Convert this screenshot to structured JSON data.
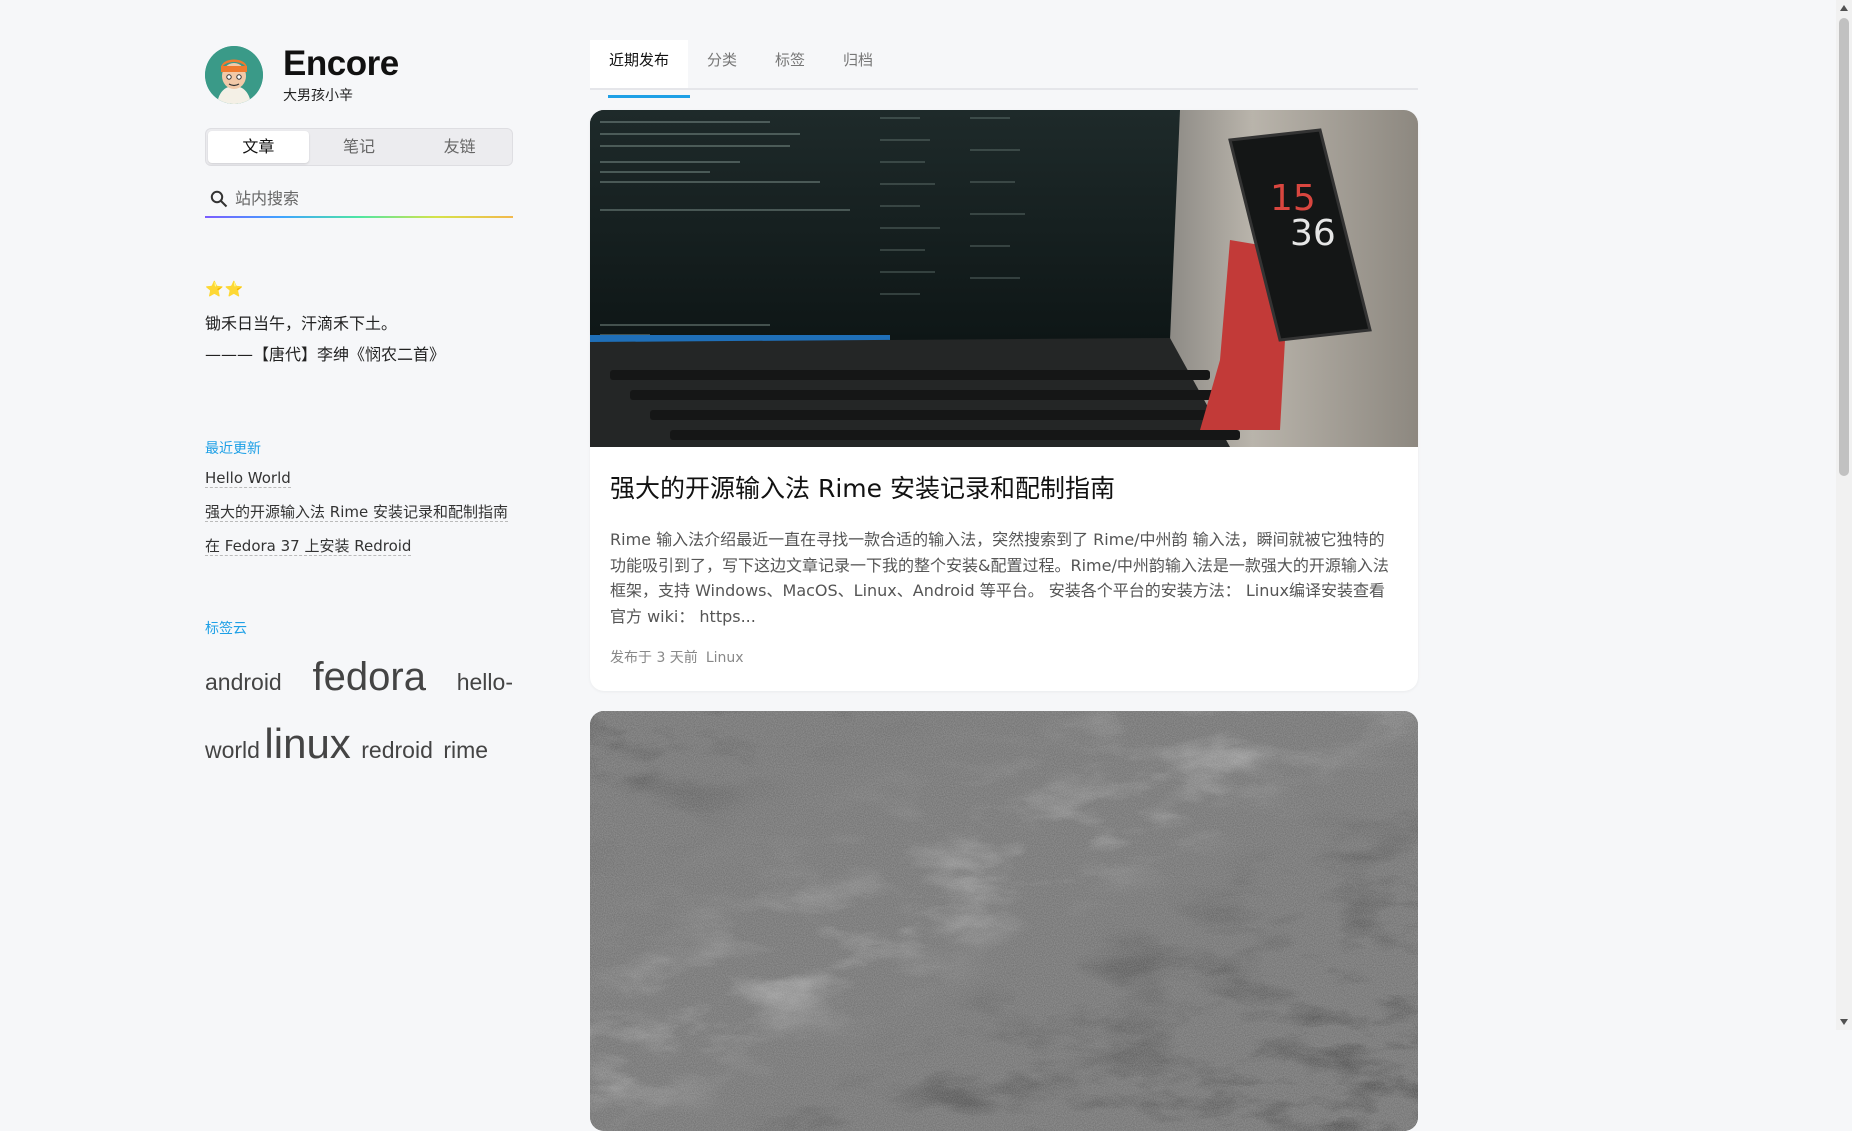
{
  "site": {
    "title": "Encore",
    "subtitle": "大男孩小辛"
  },
  "sidebar": {
    "segments": [
      "文章",
      "笔记",
      "友链"
    ],
    "search_placeholder": "站内搜索",
    "quote": {
      "stars": "⭐⭐",
      "line1": "锄禾日当午，汗滴禾下土。",
      "line2": "———【唐代】李绅《悯农二首》"
    },
    "recent_title": "最近更新",
    "recent": [
      "Hello World",
      "强大的开源输入法 Rime 安装记录和配制指南",
      "在 Fedora 37 上安装 Redroid"
    ],
    "tags_title": "标签云",
    "tags": [
      "android",
      "fedora",
      "hello-world",
      "linux",
      "redroid",
      "rime"
    ]
  },
  "main": {
    "tabs": [
      "近期发布",
      "分类",
      "标签",
      "归档"
    ],
    "post": {
      "title": "强大的开源输入法 Rime 安装记录和配制指南",
      "excerpt": "Rime 输入法介绍最近一直在寻找一款合适的输入法，突然搜索到了 Rime/中州韵 输入法，瞬间就被它独特的功能吸引到了，写下这边文章记录一下我的整个安装&配置过程。Rime/中州韵输入法是一款强大的开源输入法框架，支持 Windows、MacOS、Linux、Android 等平台。 安装各个平台的安装方法： Linux编译安装查看官方 wiki： https...",
      "meta_prefix": "发布于 3 天前",
      "category": "Linux"
    }
  },
  "colors": {
    "accent": "#1ea0e6",
    "star": "#f5b82a"
  }
}
